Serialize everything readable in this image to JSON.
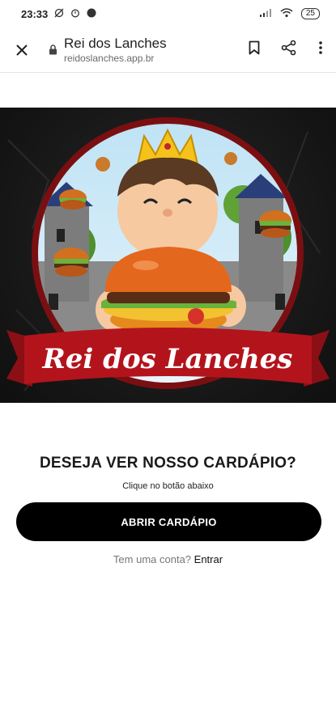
{
  "status_bar": {
    "time": "23:33",
    "battery": "25"
  },
  "browser": {
    "site_title": "Rei dos Lanches",
    "site_url": "reidoslanches.app.br"
  },
  "banner": {
    "brand_name": "Rei dos Lanches",
    "colors": {
      "ribbon": "#b3141c",
      "ring": "#7a0f12",
      "bun": "#e4671e"
    }
  },
  "main": {
    "prompt": "DESEJA VER NOSSO CARDÁPIO?",
    "hint": "Clique no botão abaixo",
    "button_label": "ABRIR CARDÁPIO",
    "account_question": "Tem uma conta?",
    "login_link": "Entrar"
  }
}
